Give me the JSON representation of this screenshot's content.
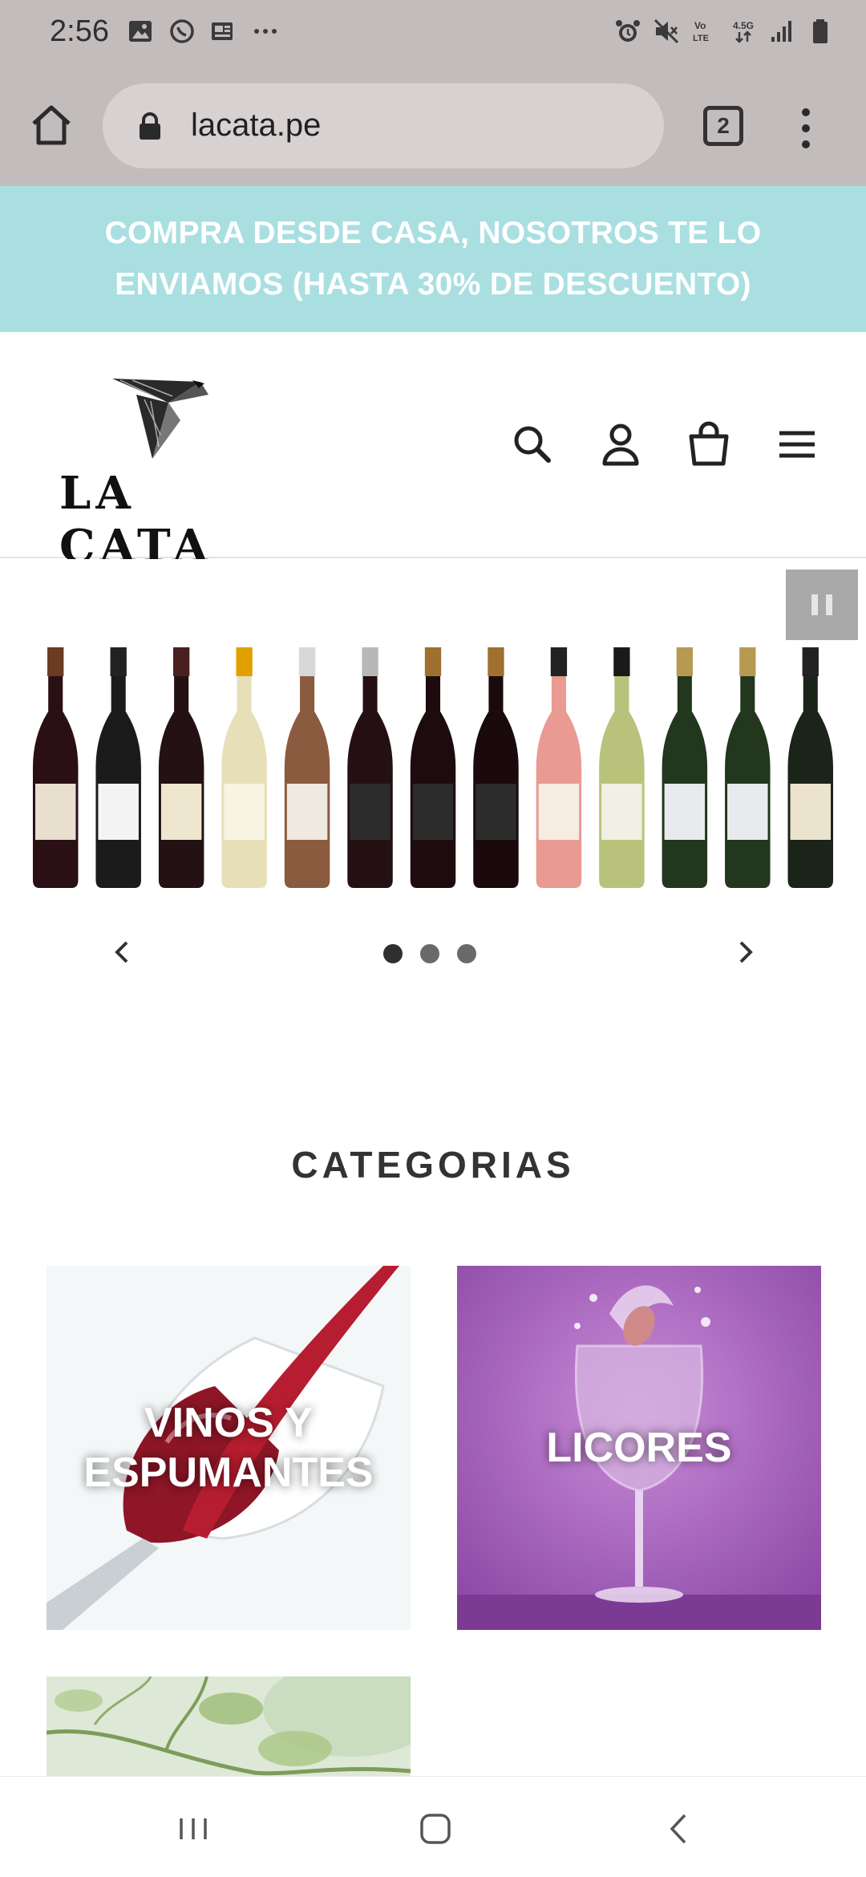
{
  "status_bar": {
    "time": "2:56",
    "left_icons": [
      "gallery-icon",
      "whatsapp-icon",
      "news-icon",
      "more-dots-icon"
    ],
    "right_icons": [
      "alarm-icon",
      "mute-icon",
      "volte-icon",
      "data-4_5g-icon",
      "signal-icon",
      "battery-icon"
    ]
  },
  "browser": {
    "url": "lacata.pe",
    "tab_count": "2"
  },
  "announcement": {
    "text": "COMPRA DESDE CASA, NOSOTROS TE LO ENVIAMOS (HASTA 30% DE DESCUENTO)",
    "background": "#a9dfe1"
  },
  "header": {
    "logo_text": "LA CATA",
    "icons": [
      "search-icon",
      "account-icon",
      "cart-icon",
      "hamburger-menu-icon"
    ]
  },
  "slideshow": {
    "slide_count": 3,
    "active_slide": 1
  },
  "categories": {
    "title": "CATEGORIAS",
    "items": [
      {
        "label_line1": "VINOS Y",
        "label_line2": "ESPUMANTES"
      },
      {
        "label_line1": "LICORES",
        "label_line2": ""
      }
    ]
  },
  "colors": {
    "chrome_bg": "#c3bcbc",
    "accent_cyan": "#a9dfe1",
    "licores_purple": "#a35dbb"
  }
}
